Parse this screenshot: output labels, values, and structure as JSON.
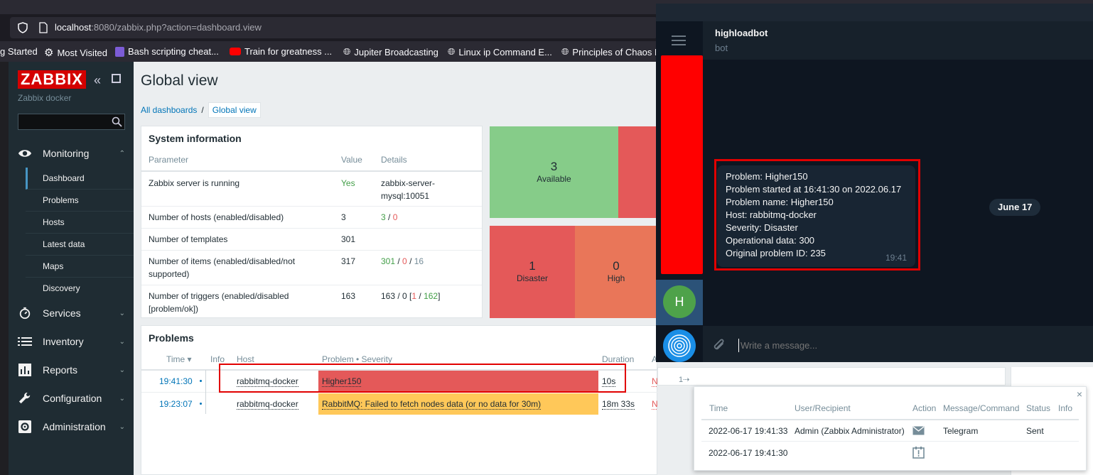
{
  "browser": {
    "url_host": "localhost",
    "url_rest": ":8080/zabbix.php?action=dashboard.view",
    "bookmarks": [
      "g Started",
      "Most Visited",
      "Bash scripting cheat...",
      "Train for greatness ...",
      "Jupiter Broadcasting",
      "Linux ip Command E...",
      "Principles of Chaos E"
    ]
  },
  "sidebar": {
    "logo": "ZABBIX",
    "subtitle": "Zabbix docker",
    "sections": [
      {
        "label": "Monitoring",
        "icon": "eye-icon"
      },
      {
        "label": "Services",
        "icon": "stopwatch-icon"
      },
      {
        "label": "Inventory",
        "icon": "list-icon"
      },
      {
        "label": "Reports",
        "icon": "bar-chart-icon"
      },
      {
        "label": "Configuration",
        "icon": "wrench-icon"
      },
      {
        "label": "Administration",
        "icon": "gear-icon"
      }
    ],
    "monitoring_items": [
      "Dashboard",
      "Problems",
      "Hosts",
      "Latest data",
      "Maps",
      "Discovery"
    ]
  },
  "main": {
    "title": "Global view",
    "breadcrumbs": [
      "All dashboards",
      "/",
      "Global view"
    ]
  },
  "system_info": {
    "title": "System information",
    "headers": [
      "Parameter",
      "Value",
      "Details"
    ],
    "rows": [
      {
        "param": "Zabbix server is running",
        "value": "Yes",
        "d1": "zabbix-server-",
        "d2": "mysql:10051"
      },
      {
        "param": "Number of hosts (enabled/disabled)",
        "value": "3",
        "a": "3",
        "sep": " / ",
        "b": "0"
      },
      {
        "param": "Number of templates",
        "value": "301"
      },
      {
        "param1": "Number of items (enabled/disabled/not",
        "param2": "supported)",
        "value": "317",
        "a": "301",
        "b": "0",
        "c": "16"
      },
      {
        "param1": "Number of triggers (enabled/disabled",
        "param2": "[problem/ok])",
        "value": "163",
        "prefix": "163 / 0 [",
        "a": "1",
        "b": "162",
        "suffix": "]"
      }
    ]
  },
  "availability": {
    "available": {
      "count": "3",
      "label": "Available"
    },
    "disaster": {
      "count": "1",
      "label": "Disaster"
    },
    "high": {
      "count": "0",
      "label": "High"
    }
  },
  "problems": {
    "title": "Problems",
    "headers": [
      "Time ▾",
      "Info",
      "Host",
      "Problem • Severity",
      "Duration",
      "A"
    ],
    "rows": [
      {
        "time": "19:41:30",
        "host": "rabbitmq-docker",
        "problem": "Higher150",
        "duration": "10s",
        "ack": "No",
        "actions": "1"
      },
      {
        "time": "19:23:07",
        "host": "rabbitmq-docker",
        "problem": "RabbitMQ: Failed to fetch nodes data (or no data for 30m)",
        "duration": "18m 33s",
        "ack": "No"
      }
    ]
  },
  "telegram": {
    "chat_name": "highloadbot",
    "chat_status": "bot",
    "avatar_letter": "H",
    "date_badge": "June 17",
    "message_lines": [
      "Problem: Higher150",
      "Problem started at 16:41:30 on 2022.06.17",
      "Problem name: Higher150",
      "Host: rabbitmq-docker",
      "Severity: Disaster",
      "Operational data: 300",
      "Original problem ID: 235"
    ],
    "message_time": "19:41",
    "input_placeholder": "Write a message..."
  },
  "actions_popup": {
    "headers": [
      "Time",
      "User/Recipient",
      "Action",
      "Message/Command",
      "Status",
      "Info"
    ],
    "rows": [
      {
        "time": "2022-06-17 19:41:33",
        "user": "Admin (Zabbix Administrator)",
        "icon": "envelope-icon",
        "message": "Telegram",
        "status": "Sent"
      },
      {
        "time": "2022-06-17 19:41:30",
        "user": "",
        "icon": "calendar-alert-icon",
        "message": "",
        "status": ""
      }
    ],
    "close": "×"
  },
  "colors": {
    "disaster": "#e45959",
    "high": "#e97659",
    "average": "#ffc859",
    "available": "#86cc89",
    "telegram_bg": "#0e1621",
    "zabbix_red": "#d40000"
  }
}
